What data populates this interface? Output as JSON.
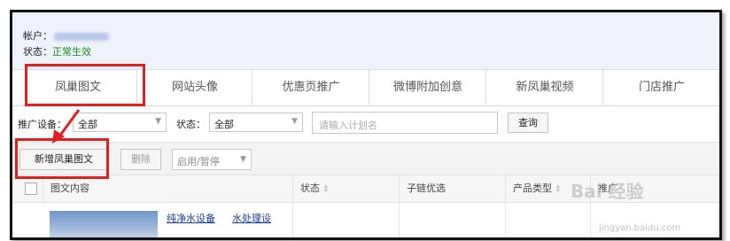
{
  "account": {
    "account_label": "帐户：",
    "status_label": "状态：",
    "status_value": "正常生效"
  },
  "tabs": [
    {
      "label": "凤巢图文",
      "active": true
    },
    {
      "label": "网站头像"
    },
    {
      "label": "优惠页推广"
    },
    {
      "label": "微博附加创意"
    },
    {
      "label": "新凤巢视频"
    },
    {
      "label": "门店推广"
    }
  ],
  "filters": {
    "device_label": "推广设备：",
    "device_value": "全部",
    "status_label": "状态：",
    "status_value": "全部",
    "plan_placeholder": "请输入计划名",
    "query_button": "查询"
  },
  "toolbar": {
    "add_button": "新增凤巢图文",
    "delete_button": "删除",
    "toggle_select": "启用/暂停"
  },
  "table": {
    "headers": [
      "图文内容",
      "状态",
      "子链优选",
      "产品类型",
      "推广"
    ],
    "row_links": [
      "纯净水设备",
      "水处理设"
    ]
  },
  "watermark": {
    "text": "Bai 经验",
    "url": "jingyan.baidu.com"
  },
  "colors": {
    "highlight": "#e02020",
    "status_ok": "#1a8c1a",
    "link": "#1a3f9a"
  }
}
